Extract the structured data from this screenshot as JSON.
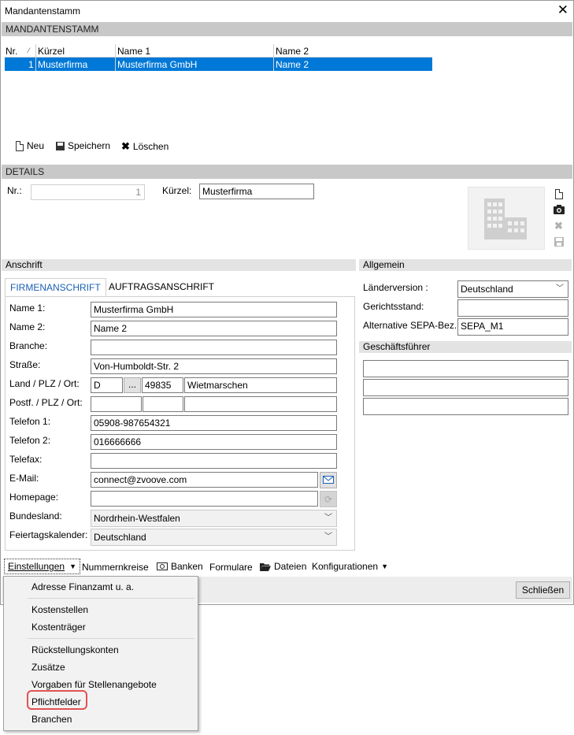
{
  "window": {
    "title": "Mandantenstamm",
    "close_glyph": "✕"
  },
  "section_mandanten": "MANDANTENSTAMM",
  "grid": {
    "columns": [
      "Nr.",
      "Kürzel",
      "Name 1",
      "Name 2"
    ],
    "rows": [
      {
        "nr": "1",
        "kuerzel": "Musterfirma",
        "name1": "Musterfirma GmbH",
        "name2": "Name 2"
      }
    ]
  },
  "toolbar": {
    "new": "Neu",
    "save": "Speichern",
    "delete": "Löschen"
  },
  "section_details": "DETAILS",
  "details": {
    "nr_label": "Nr.:",
    "nr_value": "1",
    "kuerzel_label": "Kürzel:",
    "kuerzel_value": "Musterfirma"
  },
  "anschrift": {
    "title": "Anschrift",
    "tabs": [
      "FIRMENANSCHRIFT",
      "AUFTRAGSANSCHRIFT"
    ],
    "fields": {
      "name1": {
        "label": "Name 1:",
        "value": "Musterfirma GmbH"
      },
      "name2": {
        "label": "Name 2:",
        "value": "Name 2"
      },
      "branche": {
        "label": "Branche:",
        "value": ""
      },
      "strasse": {
        "label": "Straße:",
        "value": "Von-Humboldt-Str. 2"
      },
      "land": {
        "label": "Land / PLZ / Ort:",
        "land": "D",
        "btn": "...",
        "plz": "49835",
        "ort": "Wietmarschen"
      },
      "postf": {
        "label": "Postf. / PLZ / Ort:"
      },
      "telefon1": {
        "label": "Telefon 1:",
        "value": "05908-987654321"
      },
      "telefon2": {
        "label": "Telefon 2:",
        "value": "016666666"
      },
      "telefax": {
        "label": "Telefax:",
        "value": ""
      },
      "email": {
        "label": "E-Mail:",
        "value": "connect@zvoove.com"
      },
      "homepage": {
        "label": "Homepage:",
        "value": ""
      },
      "bundesland": {
        "label": "Bundesland:",
        "value": "Nordrhein-Westfalen"
      },
      "feiertag": {
        "label": "Feiertagskalender:",
        "value": "Deutschland"
      }
    }
  },
  "allgemein": {
    "title": "Allgemein",
    "laender_label": "Länderversion :",
    "laender_value": "Deutschland",
    "gericht_label": "Gerichtsstand:",
    "gericht_value": "",
    "sepa_label": "Alternative SEPA-Bez.:",
    "sepa_value": "SEPA_M1",
    "gf_title": "Geschäftsführer"
  },
  "bottom_toolbar": {
    "einstellungen": "Einstellungen",
    "nummernkreise": "Nummernkreise",
    "banken": "Banken",
    "formulare": "Formulare",
    "dateien": "Dateien",
    "konfigurationen": "Konfigurationen"
  },
  "close_button": "Schließen",
  "menu": {
    "items": [
      "Adresse Finanzamt u. a.",
      "Kostenstellen",
      "Kostenträger",
      "Rückstellungskonten",
      "Zusätze",
      "Vorgaben für Stellenangebote",
      "Pflichtfelder",
      "Branchen"
    ],
    "highlighted": "Pflichtfelder"
  },
  "icons": [
    "new-file-icon",
    "save-icon",
    "delete-x-icon",
    "camera-icon",
    "building-placeholder-icon",
    "mail-icon",
    "link-icon",
    "card-icon",
    "folder-icon",
    "chevron-down-icon"
  ],
  "colors": {
    "selection": "#0078d7",
    "section_bar": "#c8c8c8",
    "highlight_border": "#e05353",
    "tab_active_text": "#1a5fb4"
  }
}
